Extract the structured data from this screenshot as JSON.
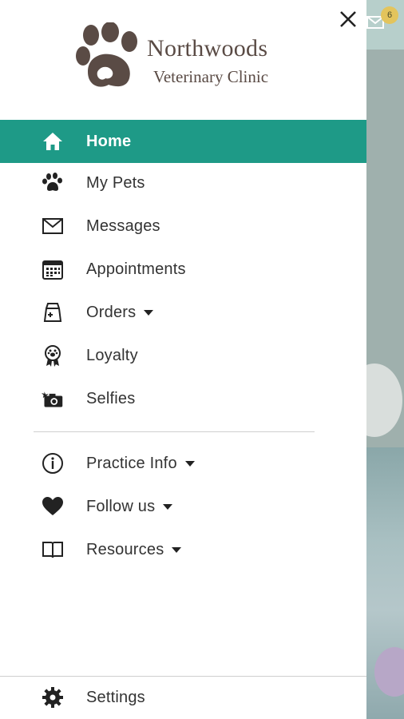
{
  "app": {
    "logo_line1": "Northwoods",
    "logo_line2": "Veterinary Clinic"
  },
  "background": {
    "mail_badge": "6"
  },
  "colors": {
    "accent": "#1e9a87",
    "logo": "#5a4b45",
    "text": "#333333"
  },
  "menu": {
    "items": [
      {
        "label": "Home",
        "icon": "home-icon",
        "active": true
      },
      {
        "label": "My Pets",
        "icon": "paw-icon"
      },
      {
        "label": "Messages",
        "icon": "envelope-icon"
      },
      {
        "label": "Appointments",
        "icon": "calendar-icon"
      },
      {
        "label": "Orders",
        "icon": "bag-icon",
        "dropdown": true
      },
      {
        "label": "Loyalty",
        "icon": "ribbon-paw-icon"
      },
      {
        "label": "Selfies",
        "icon": "camera-icon"
      }
    ],
    "secondary": [
      {
        "label": "Practice Info",
        "icon": "info-icon",
        "dropdown": true
      },
      {
        "label": "Follow us",
        "icon": "heart-icon",
        "dropdown": true
      },
      {
        "label": "Resources",
        "icon": "book-icon",
        "dropdown": true
      }
    ],
    "settings": {
      "label": "Settings",
      "icon": "gear-icon"
    }
  }
}
